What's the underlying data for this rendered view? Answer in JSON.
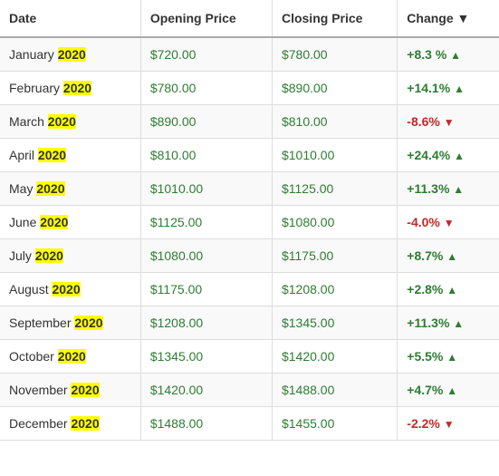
{
  "table": {
    "headers": [
      "Date",
      "Opening Price",
      "Closing Price",
      "Change ▼"
    ],
    "rows": [
      {
        "month": "January",
        "year": "2020",
        "opening": "$720.00",
        "closing": "$780.00",
        "change": "+8.3 %",
        "direction": "up"
      },
      {
        "month": "February",
        "year": "2020",
        "opening": "$780.00",
        "closing": "$890.00",
        "change": "+14.1%",
        "direction": "up"
      },
      {
        "month": "March",
        "year": "2020",
        "opening": "$890.00",
        "closing": "$810.00",
        "change": "-8.6%",
        "direction": "down"
      },
      {
        "month": "April",
        "year": "2020",
        "opening": "$810.00",
        "closing": "$1010.00",
        "change": "+24.4%",
        "direction": "up"
      },
      {
        "month": "May",
        "year": "2020",
        "opening": "$1010.00",
        "closing": "$1125.00",
        "change": "+11.3%",
        "direction": "up"
      },
      {
        "month": "June",
        "year": "2020",
        "opening": "$1125.00",
        "closing": "$1080.00",
        "change": "-4.0%",
        "direction": "down"
      },
      {
        "month": "July",
        "year": "2020",
        "opening": "$1080.00",
        "closing": "$1175.00",
        "change": "+8.7%",
        "direction": "up"
      },
      {
        "month": "August",
        "year": "2020",
        "opening": "$1175.00",
        "closing": "$1208.00",
        "change": "+2.8%",
        "direction": "up"
      },
      {
        "month": "September",
        "year": "2020",
        "opening": "$1208.00",
        "closing": "$1345.00",
        "change": "+11.3%",
        "direction": "up"
      },
      {
        "month": "October",
        "year": "2020",
        "opening": "$1345.00",
        "closing": "$1420.00",
        "change": "+5.5%",
        "direction": "up"
      },
      {
        "month": "November",
        "year": "2020",
        "opening": "$1420.00",
        "closing": "$1488.00",
        "change": "+4.7%",
        "direction": "up"
      },
      {
        "month": "December",
        "year": "2020",
        "opening": "$1488.00",
        "closing": "$1455.00",
        "change": "-2.2%",
        "direction": "down"
      }
    ]
  }
}
